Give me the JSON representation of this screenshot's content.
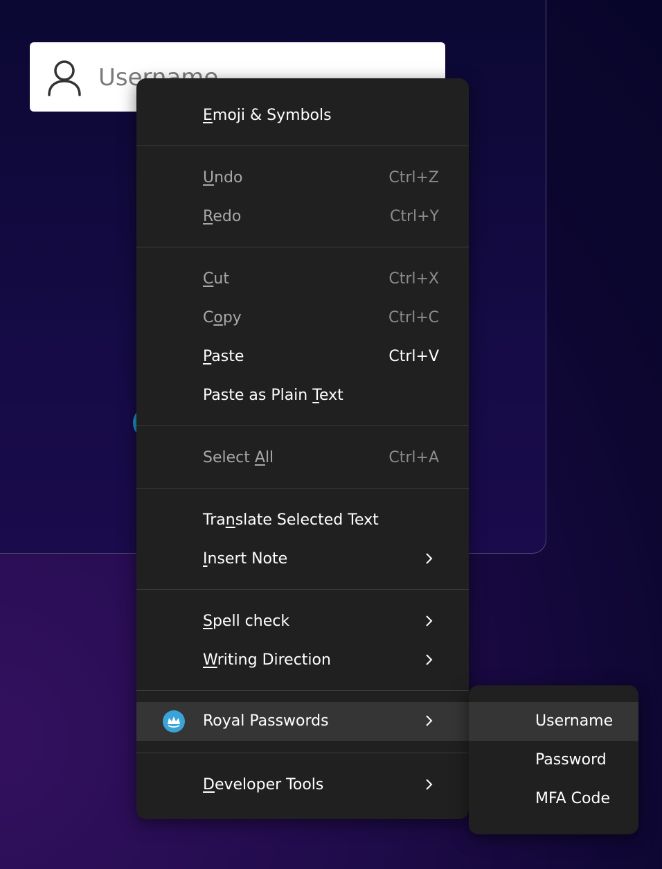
{
  "login": {
    "username_placeholder": "Username"
  },
  "context_menu": {
    "items": [
      {
        "label": "Emoji & Symbols",
        "access_key": "E"
      },
      {
        "label": "Undo",
        "access_key": "U",
        "shortcut": "Ctrl+Z",
        "disabled": true
      },
      {
        "label": "Redo",
        "access_key": "R",
        "shortcut": "Ctrl+Y",
        "disabled": true
      },
      {
        "label": "Cut",
        "access_key": "C",
        "shortcut": "Ctrl+X",
        "disabled": true
      },
      {
        "label": "Copy",
        "access_key": "o",
        "shortcut": "Ctrl+C",
        "disabled": true
      },
      {
        "label": "Paste",
        "access_key": "P",
        "shortcut": "Ctrl+V"
      },
      {
        "label": "Paste as Plain Text",
        "access_key": "T"
      },
      {
        "label": "Select All",
        "access_key": "A",
        "shortcut": "Ctrl+A",
        "disabled": true
      },
      {
        "label": "Translate Selected Text",
        "access_key": "n"
      },
      {
        "label": "Insert Note",
        "access_key": "I",
        "submenu": true
      },
      {
        "label": "Spell check",
        "access_key": "S",
        "submenu": true
      },
      {
        "label": "Writing Direction",
        "access_key": "W",
        "submenu": true
      },
      {
        "label": "Royal Passwords",
        "submenu": true,
        "highlighted": true,
        "icon": "royal-passwords-crown-icon"
      },
      {
        "label": "Developer Tools",
        "access_key": "D",
        "submenu": true
      }
    ]
  },
  "submenu": {
    "items": [
      {
        "label": "Username",
        "highlighted": true
      },
      {
        "label": "Password"
      },
      {
        "label": "MFA Code"
      }
    ]
  },
  "colors": {
    "menu_bg": "#202020",
    "highlight_bg": "#353535",
    "accent": "#3aa4d8"
  }
}
